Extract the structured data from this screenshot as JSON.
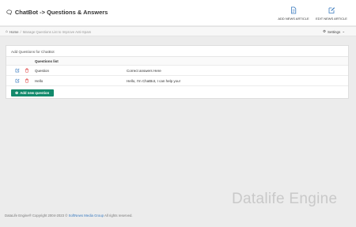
{
  "header": {
    "title": "ChatBot -> Questions & Answers",
    "actions": [
      {
        "label": "ADD NEWS ARTICLE",
        "icon": "document-icon"
      },
      {
        "label": "EDIT NEWS ARTICLE",
        "icon": "edit-icon"
      }
    ]
  },
  "breadcrumb": {
    "home": "Home",
    "separator": "/",
    "current": "Manage Questions List to Improve Anti-Spam"
  },
  "settings": {
    "label": "Settings"
  },
  "panel": {
    "title": "Add Questions for ChatBot",
    "table": {
      "header": "Questions list",
      "rows": [
        {
          "question": "Question",
          "answer": "Correct answers Here"
        },
        {
          "question": "Hello",
          "answer": "Hello, I'm ChatBot, I can help you!"
        }
      ]
    },
    "add_button": "Add new question"
  },
  "watermark": "Datalife Engine",
  "footer": {
    "prefix": "DataLife Engine® Copyright 2004-2023 ©",
    "company": "SoftNews Media Group",
    "suffix": "All rights reserved."
  },
  "colors": {
    "accent": "#138a6c",
    "icon_blue": "#3b7bbf",
    "delete_red": "#e04848",
    "background": "#ececec"
  }
}
